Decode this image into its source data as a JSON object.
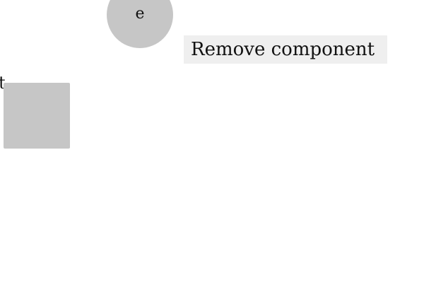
{
  "canvas": {
    "circle_node": {
      "label": "e"
    },
    "square_node_edge_label": "t",
    "remove_button": {
      "label": "Remove component"
    }
  },
  "colors": {
    "node_fill": "#c6c6c6",
    "button_background": "#efefef",
    "text": "#111111",
    "background": "#ffffff"
  }
}
